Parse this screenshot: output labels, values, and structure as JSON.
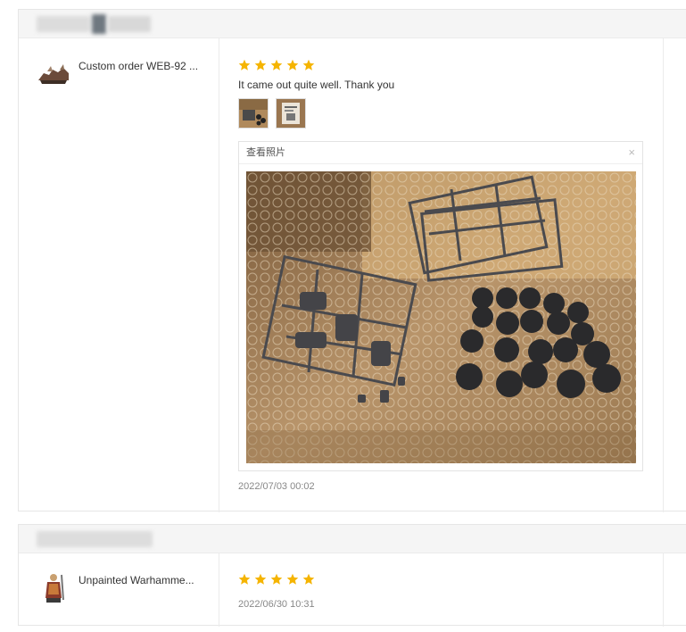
{
  "reviews": [
    {
      "product_name": "Custom order WEB-92 ...",
      "rating": 5,
      "text": "It came out quite well. Thank you",
      "viewer_title": "查看照片",
      "viewer_close": "×",
      "date": "2022/07/03 00:02"
    },
    {
      "product_name": "Unpainted Warhamme...",
      "rating": 5,
      "date": "2022/06/30 10:31"
    }
  ],
  "icons": {
    "star": "star-icon",
    "close": "close-icon"
  },
  "colors": {
    "star": "#f5b400",
    "header_bg": "#f5f5f5",
    "border": "#e6e6e6"
  }
}
